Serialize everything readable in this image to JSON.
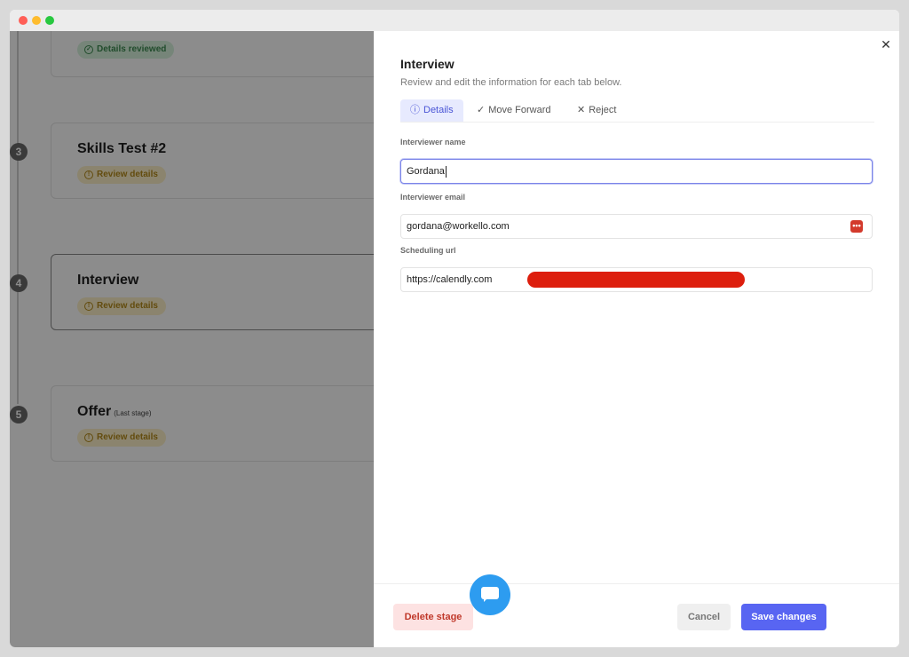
{
  "stages": [
    {
      "number": "",
      "title": "",
      "title_note": "",
      "badge": "Details reviewed",
      "badge_color": "#3c8a51"
    },
    {
      "number": "3",
      "title": "Skills Test #2",
      "title_note": "",
      "badge": "Review details",
      "badge_color": "#b48a1a"
    },
    {
      "number": "4",
      "title": "Interview",
      "title_note": "",
      "badge": "Review details",
      "badge_color": "#b48a1a"
    },
    {
      "number": "5",
      "title": "Offer",
      "title_note": "(Last stage)",
      "badge": "Review details",
      "badge_color": "#b48a1a"
    }
  ],
  "modal": {
    "title": "Interview",
    "subtitle": "Review and edit the information for each tab below.",
    "tabs": [
      {
        "label": "Details",
        "icon": "info-circle-icon",
        "active": true
      },
      {
        "label": "Move Forward",
        "icon": "check-icon",
        "active": false
      },
      {
        "label": "Reject",
        "icon": "x-icon",
        "active": false
      }
    ],
    "fields": {
      "interviewer_name": {
        "label": "Interviewer name",
        "value": "Gordana"
      },
      "interviewer_email": {
        "label": "Interviewer email",
        "value": "gordana@workello.com"
      },
      "scheduling_url": {
        "label": "Scheduling url",
        "value": "https://calendly.com"
      }
    },
    "buttons": {
      "delete": "Delete stage",
      "cancel": "Cancel",
      "save": "Save changes"
    }
  },
  "colors": {
    "accent": "#5865f2",
    "danger": "#c0392b",
    "chat": "#2d9cf0"
  }
}
